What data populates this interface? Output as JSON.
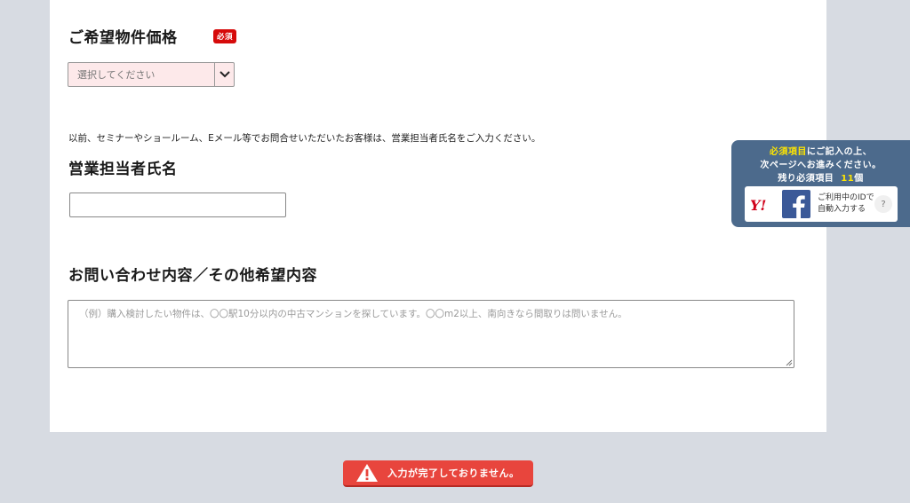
{
  "price": {
    "heading": "ご希望物件価格",
    "badge": "必須",
    "select_value": "選択してください"
  },
  "staff": {
    "note": "以前、セミナーやショールーム、Eメール等でお問合せいただいたお客様は、営業担当者氏名をご入力ください。",
    "heading": "営業担当者氏名",
    "value": ""
  },
  "inquiry": {
    "heading": "お問い合わせ内容／その他希望内容",
    "placeholder": "（例）購入検討したい物件は、〇〇駅10分以内の中古マンションを探しています。〇〇m2以上、南向きなら間取りは問いません。"
  },
  "side_panel": {
    "line1_highlight": "必須項目",
    "line1_rest": "にご記入の上、",
    "line2": "次ページへお進みください。",
    "line3_label": "残り必須項目",
    "remaining_count": "11",
    "line3_unit": "個",
    "yahoo_logo": "Y!",
    "id_text_line1": "ご利用中のIDで",
    "id_text_line2": "自動入力する",
    "help": "?"
  },
  "error_button": {
    "label": "入力が完了しておりません。"
  },
  "colors": {
    "background": "#d7dbe2",
    "badge": "#d60a0a",
    "select_bg": "#fde9ea",
    "panel": "#4c6a8c",
    "highlight": "#ffe600",
    "error": "#e8453d",
    "facebook": "#3b5998"
  },
  "icons": {
    "select_arrow": "chevron-down-icon",
    "yahoo": "yahoo-logo",
    "facebook": "facebook-logo",
    "help": "help-icon",
    "warning": "warning-icon"
  }
}
